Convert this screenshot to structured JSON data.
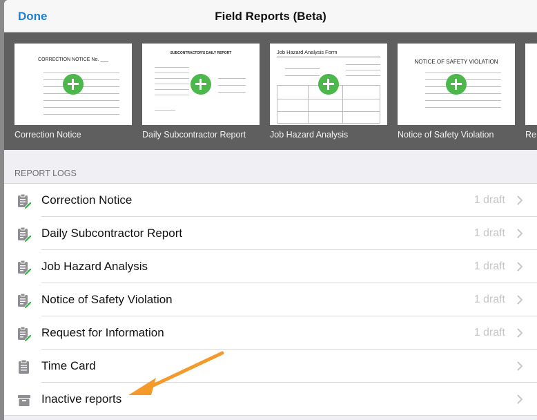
{
  "nav": {
    "done_label": "Done",
    "title": "Field Reports (Beta)"
  },
  "templates": {
    "items": [
      {
        "label": "Correction Notice",
        "doc_heading": "CORRECTION NOTICE No. ___"
      },
      {
        "label": "Daily Subcontractor Report",
        "doc_heading": "SUBCONTRACTOR'S DAILY REPORT"
      },
      {
        "label": "Job Hazard Analysis",
        "doc_heading": "Job Hazard Analysis Form"
      },
      {
        "label": "Notice of Safety Violation",
        "doc_heading": "NOTICE OF SAFETY VIOLATION"
      },
      {
        "label": "Re"
      }
    ]
  },
  "report_logs": {
    "header": "REPORT LOGS",
    "rows": [
      {
        "label": "Correction Notice",
        "count": "1 draft",
        "icon": "clipboard-edit-icon"
      },
      {
        "label": "Daily Subcontractor Report",
        "count": "1 draft",
        "icon": "clipboard-edit-icon"
      },
      {
        "label": "Job Hazard Analysis",
        "count": "1 draft",
        "icon": "clipboard-edit-icon"
      },
      {
        "label": "Notice of Safety Violation",
        "count": "1 draft",
        "icon": "clipboard-edit-icon"
      },
      {
        "label": "Request for Information",
        "count": "1 draft",
        "icon": "clipboard-edit-icon"
      },
      {
        "label": "Time Card",
        "count": "",
        "icon": "clipboard-icon"
      },
      {
        "label": "Inactive reports",
        "count": "",
        "icon": "archive-box-icon"
      }
    ]
  },
  "colors": {
    "accent": "#1d7fd6",
    "add_button": "#4cb84c",
    "pencil": "#3aa845",
    "annotation_arrow": "#f39a2b"
  },
  "annotation": {
    "type": "arrow",
    "points_to": "Inactive reports"
  }
}
